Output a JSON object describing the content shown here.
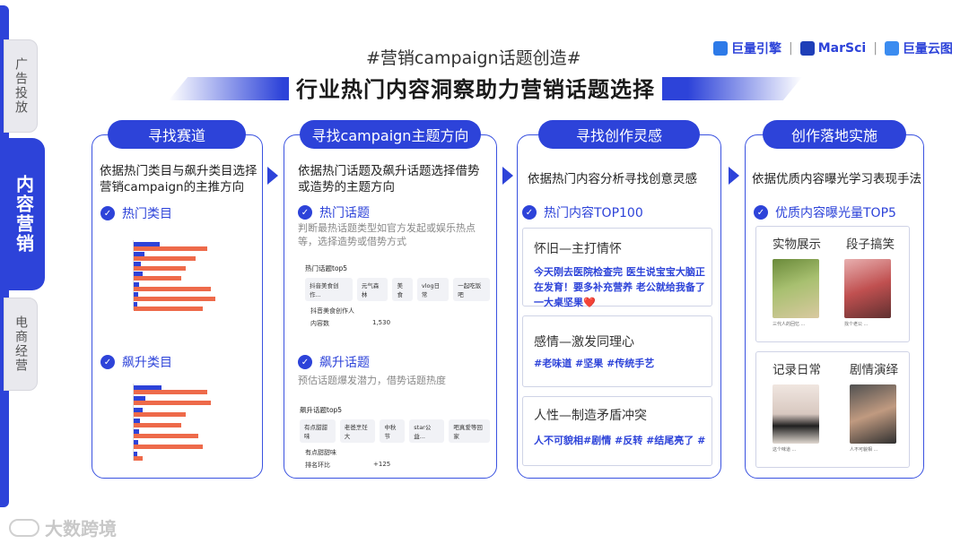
{
  "sidenav": {
    "items": [
      {
        "label": "广告投放",
        "active": false
      },
      {
        "label": "内容营销",
        "active": true
      },
      {
        "label": "电商经营",
        "active": false
      }
    ]
  },
  "header": {
    "hashtag": "#营销campaign话题创造#",
    "title": "行业热门内容洞察助力营销话题选择",
    "logos": [
      "巨量引擎",
      "MarSci",
      "巨量云图"
    ]
  },
  "columns": [
    {
      "pill": "寻找赛道",
      "desc": "依据热门类目与飙升类目选择营销campaign的主推方向",
      "sections": [
        {
          "label": "热门类目",
          "bars": [
            {
              "blue": 0.3,
              "red": 0.85
            },
            {
              "blue": 0.12,
              "red": 0.72
            },
            {
              "blue": 0.08,
              "red": 0.6
            },
            {
              "blue": 0.1,
              "red": 0.55
            },
            {
              "blue": 0.06,
              "red": 0.9
            },
            {
              "blue": 0.05,
              "red": 0.95
            },
            {
              "blue": 0.04,
              "red": 0.8
            }
          ]
        },
        {
          "label": "飙升类目",
          "bars": [
            {
              "blue": 0.32,
              "red": 0.85
            },
            {
              "blue": 0.14,
              "red": 0.9
            },
            {
              "blue": 0.1,
              "red": 0.6
            },
            {
              "blue": 0.07,
              "red": 0.55
            },
            {
              "blue": 0.06,
              "red": 0.75
            },
            {
              "blue": 0.05,
              "red": 0.8
            },
            {
              "blue": 0.04,
              "red": 0.1
            }
          ]
        }
      ]
    },
    {
      "pill": "寻找campaign主题方向",
      "desc": "依据热门话题及飙升话题选择借势或造势的主题方向",
      "sec1": {
        "label": "热门话题",
        "note": "判断最热话题类型如官方发起或娱乐热点等，选择造势或借势方式",
        "mock_title": "热门话题top5",
        "tags": [
          "抖音美食创作...",
          "元气森林",
          "美食",
          "vlog日常",
          "一起吃饭吧"
        ],
        "row_header": "抖音美食创作人",
        "row_key": "内容数",
        "row_val": "1,530"
      },
      "sec2": {
        "label": "飙升话题",
        "note": "预估话题爆发潜力，借势话题热度",
        "mock_title": "飙升话题top5",
        "tags": [
          "有点甜甜味",
          "老爸烹饪大",
          "中秋节",
          "star公益...",
          "吧真爱等回家"
        ],
        "row_header": "有点甜甜味",
        "row_key": "排名环比",
        "row_val": "+125"
      }
    },
    {
      "pill": "寻找创作灵感",
      "desc": "依据热门内容分析寻找创意灵感",
      "sub": "热门内容TOP100",
      "cards": [
        {
          "title": "怀旧—主打情怀",
          "body": "今天刚去医院检查完 医生说宝宝大脑正在发育！要多补充营养 老公就给我备了一大桌坚果❤️"
        },
        {
          "title": "感情—激发同理心",
          "body": "#老味道 #坚果 #传统手艺"
        },
        {
          "title": "人性—制造矛盾冲突",
          "body": "人不可貌相#剧情 #反转 #结尾亮了 #"
        }
      ]
    },
    {
      "pill": "创作落地实施",
      "desc": "依据优质内容曝光学习表现手法",
      "sub": "优质内容曝光量TOP5",
      "cards": [
        {
          "labels": [
            "实物展示",
            "段子搞笑"
          ],
          "caps": [
            "三代人的回忆 ...",
            "找个老公 ..."
          ]
        },
        {
          "labels": [
            "记录日常",
            "剧情演绎"
          ],
          "caps": [
            "这个味道 ...",
            "人不可貌相 ..."
          ]
        }
      ]
    }
  ],
  "watermark": "大数跨境",
  "colors": {
    "brand": "#2d43d9",
    "bar_red": "#ee6a4a",
    "bar_blue": "#2d43d9"
  }
}
